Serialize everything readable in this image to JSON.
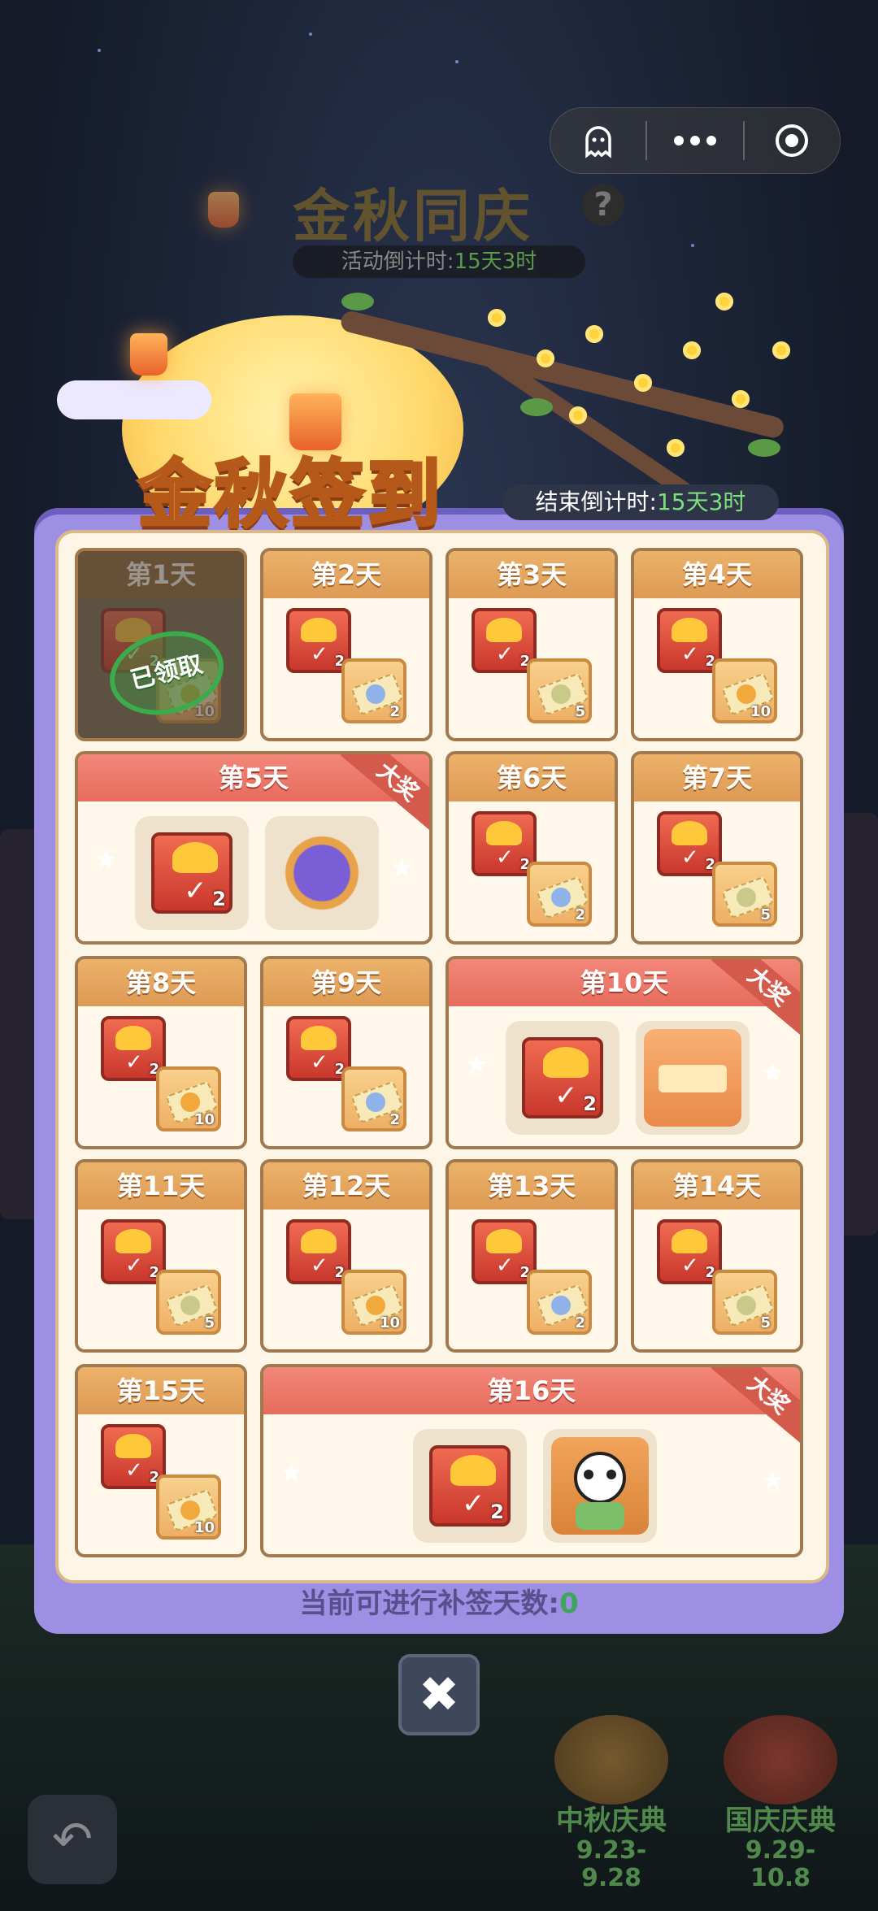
{
  "bg_header": {
    "title": "金秋同庆",
    "help": "?",
    "countdown_label": "活动倒计时:",
    "countdown_value": "15天3时"
  },
  "title": "金秋签到",
  "end_countdown": {
    "label": "结束倒计时:",
    "value": "15天3时"
  },
  "days": [
    {
      "label": "第1天",
      "status": "已领取",
      "items": [
        {
          "type": "red-packet",
          "count": "2"
        },
        {
          "type": "ticket-gold",
          "count": "10"
        }
      ]
    },
    {
      "label": "第2天",
      "items": [
        {
          "type": "red-packet",
          "count": "2"
        },
        {
          "type": "ticket-color",
          "count": "2"
        }
      ]
    },
    {
      "label": "第3天",
      "items": [
        {
          "type": "red-packet",
          "count": "2"
        },
        {
          "type": "ticket-silver",
          "count": "5"
        }
      ]
    },
    {
      "label": "第4天",
      "items": [
        {
          "type": "red-packet",
          "count": "2"
        },
        {
          "type": "ticket-gold",
          "count": "10"
        }
      ]
    },
    {
      "label": "第5天",
      "badge": "大奖",
      "items": [
        {
          "type": "red-packet",
          "count": "2"
        },
        {
          "type": "avatar-frame",
          "count": ""
        }
      ]
    },
    {
      "label": "第6天",
      "items": [
        {
          "type": "red-packet",
          "count": "2"
        },
        {
          "type": "ticket-color",
          "count": "2"
        }
      ]
    },
    {
      "label": "第7天",
      "items": [
        {
          "type": "red-packet",
          "count": "2"
        },
        {
          "type": "ticket-silver",
          "count": "5"
        }
      ]
    },
    {
      "label": "第8天",
      "items": [
        {
          "type": "red-packet",
          "count": "2"
        },
        {
          "type": "ticket-gold",
          "count": "10"
        }
      ]
    },
    {
      "label": "第9天",
      "items": [
        {
          "type": "red-packet",
          "count": "2"
        },
        {
          "type": "ticket-color",
          "count": "2"
        }
      ]
    },
    {
      "label": "第10天",
      "badge": "大奖",
      "items": [
        {
          "type": "red-packet",
          "count": "2"
        },
        {
          "type": "scroll-banner",
          "count": ""
        }
      ]
    },
    {
      "label": "第11天",
      "items": [
        {
          "type": "red-packet",
          "count": "2"
        },
        {
          "type": "ticket-silver",
          "count": "5"
        }
      ]
    },
    {
      "label": "第12天",
      "items": [
        {
          "type": "red-packet",
          "count": "2"
        },
        {
          "type": "ticket-gold",
          "count": "10"
        }
      ]
    },
    {
      "label": "第13天",
      "items": [
        {
          "type": "red-packet",
          "count": "2"
        },
        {
          "type": "ticket-color",
          "count": "2"
        }
      ]
    },
    {
      "label": "第14天",
      "items": [
        {
          "type": "red-packet",
          "count": "2"
        },
        {
          "type": "ticket-silver",
          "count": "5"
        }
      ]
    },
    {
      "label": "第15天",
      "items": [
        {
          "type": "red-packet",
          "count": "2"
        },
        {
          "type": "ticket-gold",
          "count": "10"
        }
      ]
    },
    {
      "label": "第16天",
      "badge": "大奖",
      "items": [
        {
          "type": "red-packet",
          "count": "2"
        },
        {
          "type": "panda-avatar",
          "count": ""
        }
      ]
    }
  ],
  "makeup": {
    "label": "当前可进行补签天数:",
    "value": "0"
  },
  "close_icon": "close-icon",
  "back_icon": "back-arrow-icon",
  "events": [
    {
      "name": "中秋庆典",
      "dates": "9.23-9.28"
    },
    {
      "name": "国庆庆典",
      "dates": "9.29-10.8"
    }
  ],
  "colors": {
    "panel": "#9d8fe3",
    "cell_header": "#dd9a55",
    "grand_header": "#e66c5c",
    "claimed_stamp": "#3bab4c",
    "countdown_value": "#7de07a"
  }
}
